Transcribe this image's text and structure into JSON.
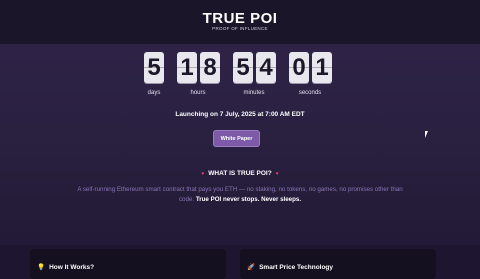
{
  "header": {
    "title": "TRUE POI",
    "subtitle": "PROOF OF INFLUENCE"
  },
  "countdown": {
    "digits": [
      "5",
      "1",
      "8",
      "5",
      "4",
      "0",
      "1"
    ],
    "labels": {
      "days": "days",
      "hours": "hours",
      "minutes": "minutes",
      "seconds": "seconds"
    }
  },
  "launch_text": "Launching on 7 July, 2025 at 7:00 AM EDT",
  "white_paper_label": "White Paper",
  "what_is": {
    "heading": "WHAT IS TRUE POI?",
    "heart": "♥",
    "description": "A self-running Ethereum smart contract that pays you ETH — no staking, no tokens, no games, no promises other than code.",
    "emphasis": "True POI never stops. Never sleeps."
  },
  "cards": [
    {
      "icon": "💡",
      "icon_name": "lightbulb-icon",
      "title": "How It Works?"
    },
    {
      "icon": "🚀",
      "icon_name": "rocket-icon",
      "title": "Smart Price Technology"
    }
  ],
  "colors": {
    "background": "#1e1630",
    "button": "#7c5aa8",
    "description_text": "#8a74b3",
    "heart": "#e0476f"
  }
}
